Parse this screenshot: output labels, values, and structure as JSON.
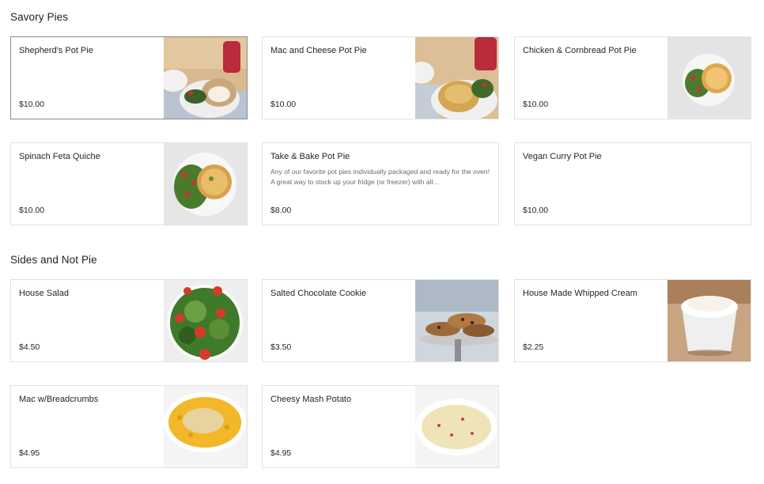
{
  "sections": [
    {
      "title": "Savory Pies",
      "items": [
        {
          "name": "Shepherd's Pot Pie",
          "price": "$10.00",
          "image": "shepherds-pot-pie-photo"
        },
        {
          "name": "Mac and Cheese Pot Pie",
          "price": "$10.00",
          "image": "mac-cheese-pot-pie-photo"
        },
        {
          "name": "Chicken & Cornbread Pot Pie",
          "price": "$10.00",
          "image": "chicken-cornbread-pot-pie-photo"
        },
        {
          "name": "Spinach Feta Quiche",
          "price": "$10.00",
          "image": "spinach-feta-quiche-photo"
        },
        {
          "name": "Take & Bake Pot Pie",
          "description": "Any of our favorite pot pies individually packaged and ready for the oven! A great way to stock up your fridge (or freezer) with all...",
          "price": "$8.00"
        },
        {
          "name": "Vegan Curry Pot Pie",
          "price": "$10.00"
        }
      ]
    },
    {
      "title": "Sides and Not Pie",
      "items": [
        {
          "name": "House Salad",
          "price": "$4.50",
          "image": "house-salad-photo"
        },
        {
          "name": "Salted Chocolate Cookie",
          "price": "$3.50",
          "image": "chocolate-cookie-photo"
        },
        {
          "name": "House Made Whipped Cream",
          "price": "$2.25",
          "image": "whipped-cream-photo"
        },
        {
          "name": "Mac w/Breadcrumbs",
          "price": "$4.95",
          "image": "mac-breadcrumbs-photo"
        },
        {
          "name": "Cheesy Mash Potato",
          "price": "$4.95",
          "image": "cheesy-mash-potato-photo"
        }
      ]
    }
  ]
}
